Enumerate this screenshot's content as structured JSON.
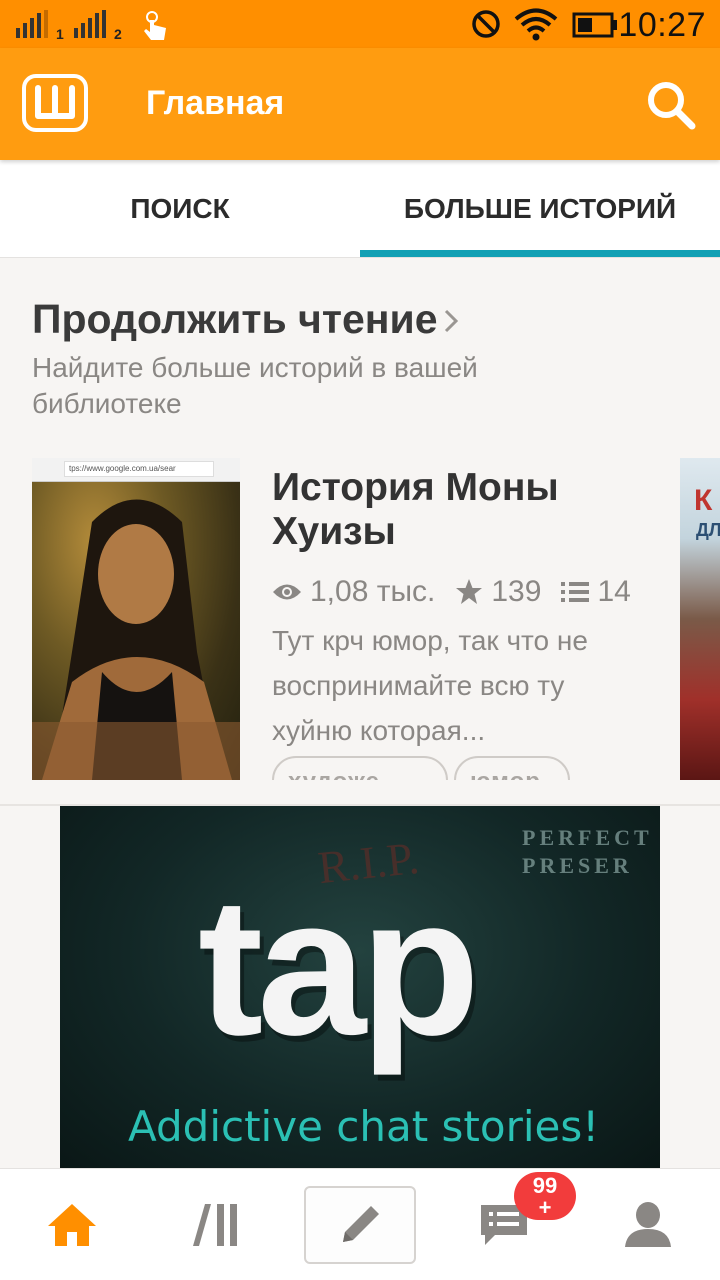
{
  "status_bar": {
    "sim1": "1",
    "sim2": "2",
    "time": "10:27",
    "icons": [
      "signal-icon",
      "signal-icon",
      "touch-icon",
      "do-not-disturb-icon",
      "wifi-icon",
      "battery-icon"
    ]
  },
  "app_bar": {
    "logo_letter": "Ш",
    "title": "Главная",
    "accent": "#ff9c10"
  },
  "tabs": [
    {
      "label": "ПОИСК",
      "active": false
    },
    {
      "label": "БОЛЬШЕ ИСТОРИЙ",
      "active": true
    }
  ],
  "continue_reading": {
    "title": "Продолжить чтение",
    "subtitle": "Найдите больше историй в вашей библиотеке",
    "story": {
      "cover_url": "tps://www.google.com.ua/sear",
      "title": "История Моны Хуизы",
      "reads": "1,08 тыс.",
      "votes": "139",
      "parts": "14",
      "description": "Тут крч юмор, так что не воспринимайте всю ту хуйню которая...",
      "tags": [
        "художе...",
        "юмор"
      ]
    },
    "next_cover_text": "К",
    "next_cover_sub": "ДЛ"
  },
  "ad": {
    "rip_text": "R.I.P.",
    "perfect_text": "PERFECT PRESER",
    "logo": "tap",
    "tagline": "Addictive chat stories!"
  },
  "bottom_nav": {
    "items": [
      "home-icon",
      "library-icon",
      "write-icon",
      "inbox-icon",
      "profile-icon"
    ],
    "badge": "99\n+"
  }
}
